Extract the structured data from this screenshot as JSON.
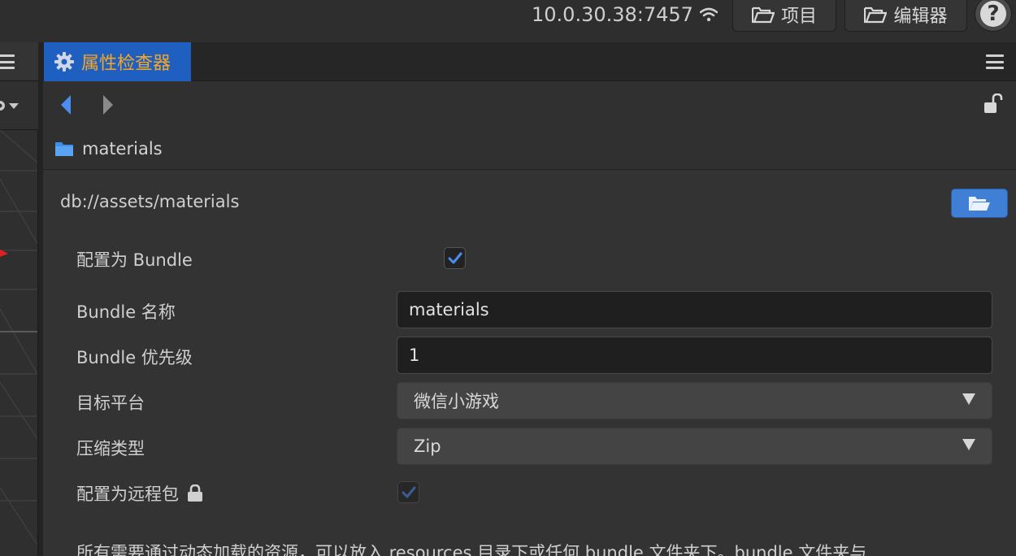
{
  "topbar": {
    "ip": "10.0.30.38:7457",
    "project_label": "项目",
    "editor_label": "编辑器",
    "help_label": "?"
  },
  "inspector": {
    "tab_title": "属性检查器",
    "breadcrumb": "materials",
    "path": "db://assets/materials"
  },
  "properties": {
    "bundle_label": "配置为 Bundle",
    "bundle_checked": true,
    "bundle_name_label": "Bundle 名称",
    "bundle_name_value": "materials",
    "bundle_priority_label": "Bundle 优先级",
    "bundle_priority_value": "1",
    "target_platform_label": "目标平台",
    "target_platform_value": "微信小游戏",
    "compression_label": "压缩类型",
    "compression_value": "Zip",
    "remote_label": "配置为远程包",
    "remote_checked": true
  },
  "description": "所有需要通过动态加载的资源，可以放入 resources 目录下或任何 bundle 文件夹下。bundle 文件夹与",
  "colors": {
    "accent": "#1f5fc0",
    "tab_text": "#f5a623",
    "check": "#4a8ff0",
    "open_button": "#3f7fd6"
  }
}
